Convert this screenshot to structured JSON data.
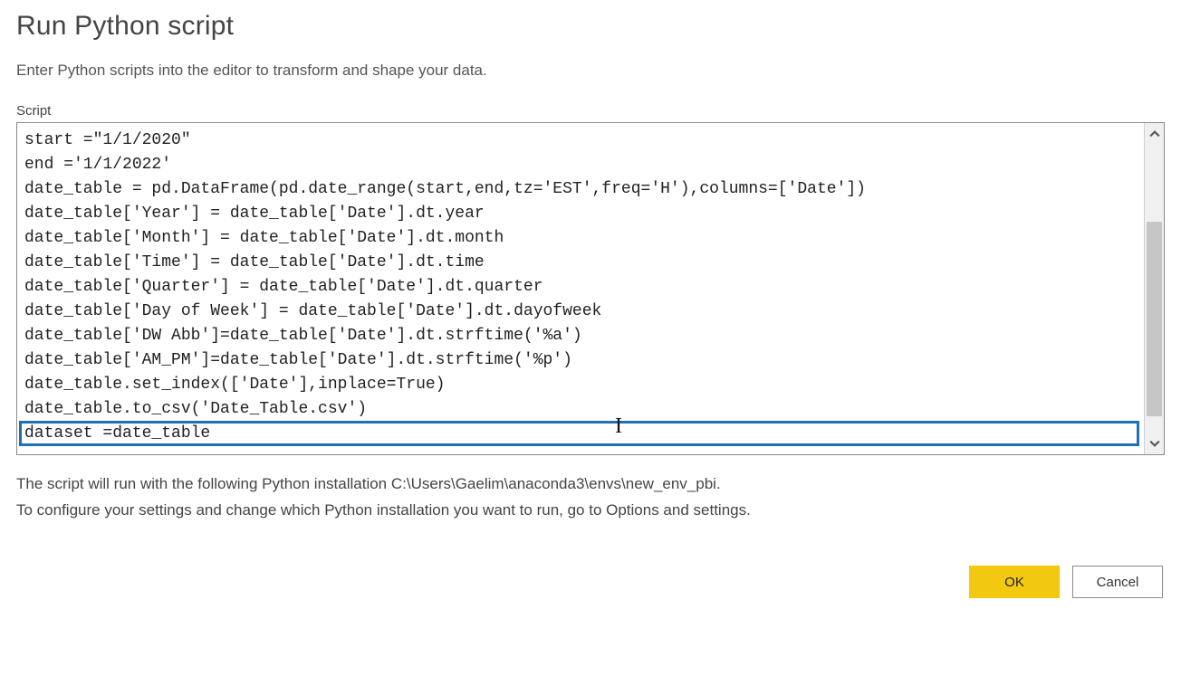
{
  "dialog": {
    "title": "Run Python script",
    "subtitle": "Enter Python scripts into the editor to transform and shape your data.",
    "script_label": "Script"
  },
  "script": {
    "lines": [
      "start =\"1/1/2020\"",
      "end ='1/1/2022'",
      "date_table = pd.DataFrame(pd.date_range(start,end,tz='EST',freq='H'),columns=['Date'])",
      "date_table['Year'] = date_table['Date'].dt.year",
      "date_table['Month'] = date_table['Date'].dt.month",
      "date_table['Time'] = date_table['Date'].dt.time",
      "date_table['Quarter'] = date_table['Date'].dt.quarter",
      "date_table['Day of Week'] = date_table['Date'].dt.dayofweek",
      "date_table['DW Abb']=date_table['Date'].dt.strftime('%a')",
      "date_table['AM_PM']=date_table['Date'].dt.strftime('%p')",
      "date_table.set_index(['Date'],inplace=True)",
      "date_table.to_csv('Date_Table.csv')",
      "dataset =date_table"
    ],
    "highlighted_line_index": 12
  },
  "info": {
    "line1": "The script will run with the following Python installation C:\\Users\\Gaelim\\anaconda3\\envs\\new_env_pbi.",
    "line2": "To configure your settings and change which Python installation you want to run, go to Options and settings."
  },
  "buttons": {
    "ok": "OK",
    "cancel": "Cancel"
  }
}
